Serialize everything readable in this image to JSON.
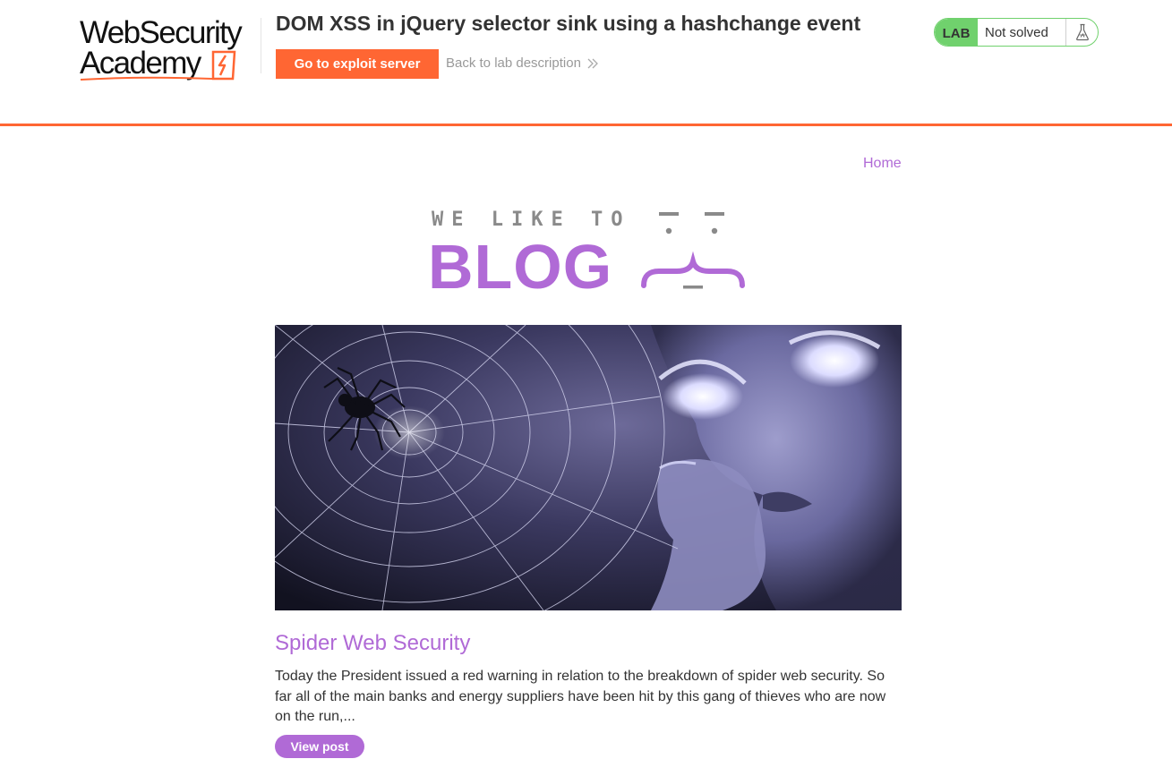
{
  "academy": {
    "logo_line1": "WebSecurity",
    "logo_line2": "Academy",
    "lab_title": "DOM XSS in jQuery selector sink using a hashchange event",
    "exploit_button": "Go to exploit server",
    "back_link": "Back to lab description",
    "lab_badge": "LAB",
    "lab_status": "Not solved",
    "flask_icon": "flask-icon",
    "chevron_icon": "double-chevron-right-icon"
  },
  "nav": {
    "home": "Home"
  },
  "banner": {
    "tagline": "WE LIKE TO",
    "word": "BLOG"
  },
  "post": {
    "title": "Spider Web Security",
    "excerpt": "Today the President issued a red warning in relation to the breakdown of spider web security. So far all of the main banks and energy suppliers have been hit by this gang of thieves who are now on the run,...",
    "button": "View post"
  },
  "colors": {
    "academy_orange": "#ff6633",
    "blog_purple": "#b06ad6",
    "lab_green": "#70d16d",
    "text": "#333333",
    "muted": "#999999"
  }
}
